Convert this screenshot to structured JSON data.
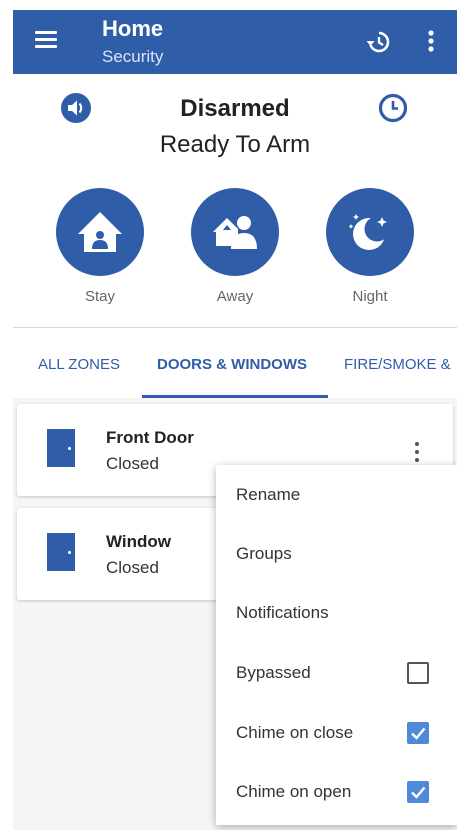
{
  "appbar": {
    "title": "Home",
    "subtitle": "Security"
  },
  "icons": {
    "menu": "menu-icon",
    "history": "history-icon",
    "more": "more-vert-icon",
    "speaker": "speaker-icon",
    "clock": "clock-icon",
    "stay": "stay-home-icon",
    "away": "away-users-icon",
    "night": "night-moon-icon",
    "door": "door-icon"
  },
  "status": {
    "title": "Disarmed",
    "subtitle": "Ready To Arm"
  },
  "arm_buttons": [
    {
      "label": "Stay"
    },
    {
      "label": "Away"
    },
    {
      "label": "Night"
    }
  ],
  "tabs": [
    {
      "label": "ALL ZONES"
    },
    {
      "label": "DOORS & WINDOWS"
    },
    {
      "label": "FIRE/SMOKE &"
    }
  ],
  "zones": [
    {
      "name": "Front Door",
      "state": "Closed"
    },
    {
      "name": "Window",
      "state": "Closed"
    }
  ],
  "menu": {
    "items": [
      {
        "label": "Rename"
      },
      {
        "label": "Groups"
      },
      {
        "label": "Notifications"
      },
      {
        "label": "Bypassed",
        "checked": false
      },
      {
        "label": "Chime on close",
        "checked": true
      },
      {
        "label": "Chime on open",
        "checked": true
      }
    ]
  },
  "colors": {
    "primary": "#2f5da8",
    "checkbox_on": "#4f8ad9"
  }
}
